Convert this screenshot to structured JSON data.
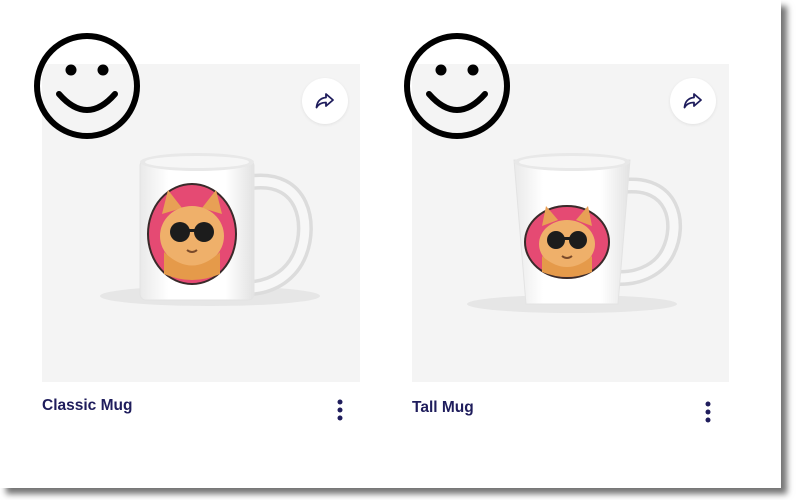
{
  "products": [
    {
      "title": "Classic Mug",
      "share_icon": "share-arrow-icon",
      "menu_icon": "more-vertical-icon"
    },
    {
      "title": "Tall Mug",
      "share_icon": "share-arrow-icon",
      "menu_icon": "more-vertical-icon"
    }
  ],
  "overlay": {
    "icon": "smiley-face-icon"
  },
  "artwork": {
    "subject": "orange cat with sunglasses",
    "circle_color": "#e54a73"
  },
  "colors": {
    "title_text": "#1f1d5c",
    "card_bg": "#f4f4f4",
    "icon_color": "#1f1d5c"
  }
}
